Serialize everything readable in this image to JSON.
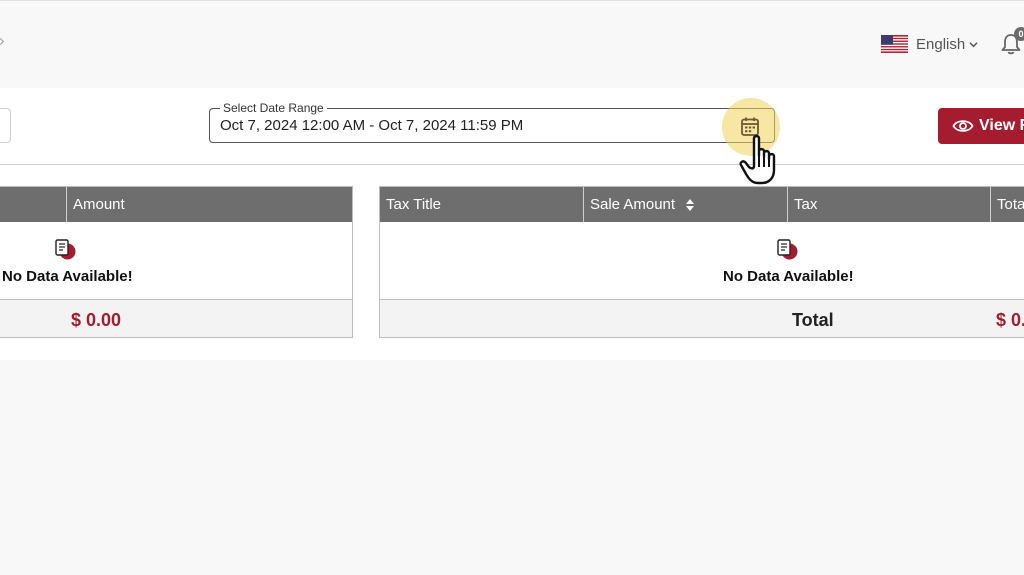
{
  "header": {
    "language": "English",
    "language_flag": "us-flag-icon",
    "notification_count": "0"
  },
  "filters": {
    "date_range_label": "Select Date Range",
    "date_range_value": "Oct 7, 2024 12:00 AM - Oct 7, 2024 11:59 PM",
    "view_button_label": "View R"
  },
  "left_table": {
    "columns": [
      "Amount"
    ],
    "empty_message": "No Data Available!",
    "footer_amount": "$ 0.00"
  },
  "right_table": {
    "columns": [
      "Tax Title",
      "Sale Amount",
      "Tax",
      "Tota"
    ],
    "sortable_column": "Sale Amount",
    "empty_message": "No Data Available!",
    "footer_label": "Total",
    "footer_amount": "$ 0."
  },
  "colors": {
    "accent": "#a51c30",
    "header_gray": "#6e6e6e",
    "highlight": "#f0d25a"
  },
  "icons": [
    "us-flag-icon",
    "chevron-down-icon",
    "bell-icon",
    "calendar-icon",
    "pointer-hand-icon",
    "eye-icon",
    "no-data-icon",
    "sort-icon"
  ]
}
